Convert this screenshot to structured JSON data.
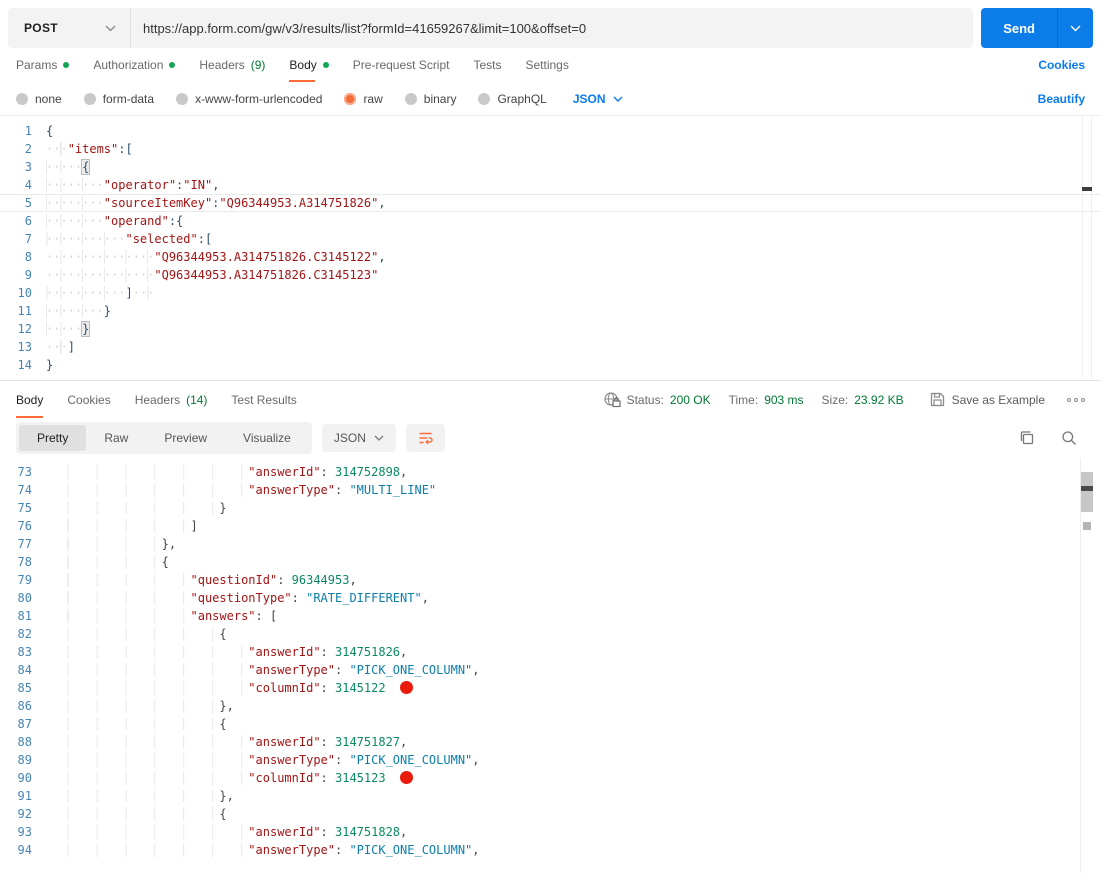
{
  "colors": {
    "accent_orange": "#FF6C37",
    "link_blue": "#097BED",
    "send_button_blue": "#0B7CE8",
    "success_green": "#007A33",
    "indicator_green_dot": "#13A454",
    "marker_red": "#EA1B0D",
    "syntax_key_maroon": "#A31515",
    "syntax_string_teal": "#0D7EA8",
    "syntax_number_green": "#0A8A64",
    "line_number_blue": "#4585B5"
  },
  "request": {
    "method": "POST",
    "url": "https://app.form.com/gw/v3/results/list?formId=41659267&limit=100&offset=0",
    "send_label": "Send",
    "cookies_link": "Cookies",
    "beautify_link": "Beautify",
    "language_selector": "JSON",
    "tabs": [
      {
        "label": "Params",
        "dot": true
      },
      {
        "label": "Authorization",
        "dot": true
      },
      {
        "label": "Headers",
        "count": "(9)"
      },
      {
        "label": "Body",
        "dot": true,
        "active": true
      },
      {
        "label": "Pre-request Script"
      },
      {
        "label": "Tests"
      },
      {
        "label": "Settings"
      }
    ],
    "body_modes": [
      {
        "label": "none"
      },
      {
        "label": "form-data"
      },
      {
        "label": "x-www-form-urlencoded"
      },
      {
        "label": "raw",
        "selected": true
      },
      {
        "label": "binary"
      },
      {
        "label": "GraphQL"
      }
    ],
    "editor_lines": [
      {
        "no": 1,
        "text": "{"
      },
      {
        "no": 2,
        "text": "   \"items\":["
      },
      {
        "no": 3,
        "text": "     {",
        "bracketBox": true
      },
      {
        "no": 4,
        "text": "        \"operator\":\"IN\","
      },
      {
        "no": 5,
        "text": "        \"sourceItemKey\":\"Q96344953.A314751826\",",
        "current": true
      },
      {
        "no": 6,
        "text": "        \"operand\":{"
      },
      {
        "no": 7,
        "text": "           \"selected\":["
      },
      {
        "no": 8,
        "text": "               \"Q96344953.A314751826.C3145122\","
      },
      {
        "no": 9,
        "text": "               \"Q96344953.A314751826.C3145123\""
      },
      {
        "no": 10,
        "text": "           ]   "
      },
      {
        "no": 11,
        "text": "        }"
      },
      {
        "no": 12,
        "text": "     }",
        "bracketBox": true
      },
      {
        "no": 13,
        "text": "   ]"
      },
      {
        "no": 14,
        "text": "}"
      }
    ]
  },
  "response": {
    "tabs": [
      {
        "label": "Body",
        "active": true
      },
      {
        "label": "Cookies"
      },
      {
        "label": "Headers",
        "count": "(14)"
      },
      {
        "label": "Test Results"
      }
    ],
    "meta": {
      "status_label": "Status:",
      "status_value": "200 OK",
      "time_label": "Time:",
      "time_value": "903 ms",
      "size_label": "Size:",
      "size_value": "23.92 KB",
      "save_as_example": "Save as Example"
    },
    "views": [
      {
        "label": "Pretty",
        "active": true
      },
      {
        "label": "Raw"
      },
      {
        "label": "Preview"
      },
      {
        "label": "Visualize"
      }
    ],
    "language_selector": "JSON",
    "editor_lines": [
      {
        "no": 73,
        "text": "                            \"answerId\": 314752898,"
      },
      {
        "no": 74,
        "text": "                            \"answerType\": \"MULTI_LINE\""
      },
      {
        "no": 75,
        "text": "                        }"
      },
      {
        "no": 76,
        "text": "                    ]"
      },
      {
        "no": 77,
        "text": "                },"
      },
      {
        "no": 78,
        "text": "                {"
      },
      {
        "no": 79,
        "text": "                    \"questionId\": 96344953,"
      },
      {
        "no": 80,
        "text": "                    \"questionType\": \"RATE_DIFFERENT\","
      },
      {
        "no": 81,
        "text": "                    \"answers\": ["
      },
      {
        "no": 82,
        "text": "                        {"
      },
      {
        "no": 83,
        "text": "                            \"answerId\": 314751826,"
      },
      {
        "no": 84,
        "text": "                            \"answerType\": \"PICK_ONE_COLUMN\","
      },
      {
        "no": 85,
        "text": "                            \"columnId\": 3145122",
        "marker": true
      },
      {
        "no": 86,
        "text": "                        },"
      },
      {
        "no": 87,
        "text": "                        {"
      },
      {
        "no": 88,
        "text": "                            \"answerId\": 314751827,"
      },
      {
        "no": 89,
        "text": "                            \"answerType\": \"PICK_ONE_COLUMN\","
      },
      {
        "no": 90,
        "text": "                            \"columnId\": 3145123",
        "marker": true
      },
      {
        "no": 91,
        "text": "                        },"
      },
      {
        "no": 92,
        "text": "                        {"
      },
      {
        "no": 93,
        "text": "                            \"answerId\": 314751828,"
      },
      {
        "no": 94,
        "text": "                            \"answerType\": \"PICK_ONE_COLUMN\","
      }
    ]
  }
}
